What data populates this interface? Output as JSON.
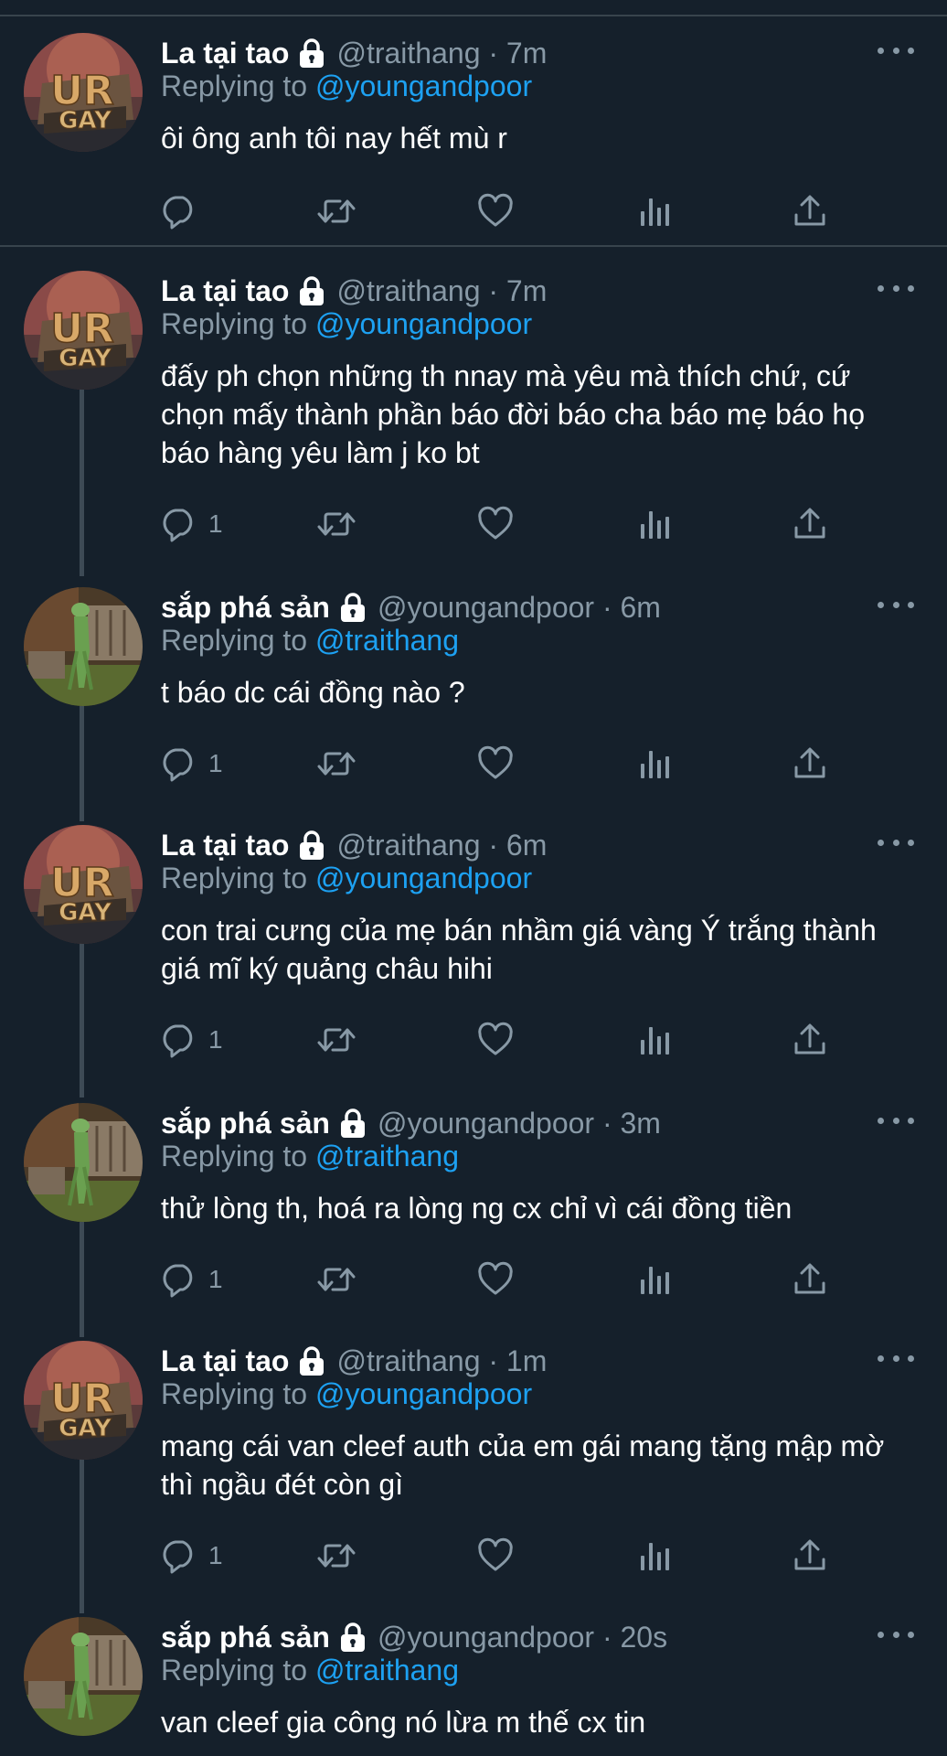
{
  "tweets": [
    {
      "author": "La tại tao",
      "handle_time": "@traithang · 7m",
      "reply_prefix": "Replying to",
      "reply_to": "@youngandpoor",
      "text": "ôi ông anh tôi nay hết mù r",
      "reply_count": "",
      "avatar": "ur-gay-logo"
    },
    {
      "author": "La tại tao",
      "handle_time": "@traithang · 7m",
      "reply_prefix": "Replying to",
      "reply_to": "@youngandpoor",
      "text": "đấy ph chọn những th nnay mà yêu mà thích chứ, cứ chọn mấy thành phần báo đời báo cha báo mẹ báo họ báo hàng yêu làm j ko bt",
      "reply_count": "1",
      "avatar": "ur-gay-logo"
    },
    {
      "author": "sắp phá sản",
      "handle_time": "@youngandpoor · 6m",
      "reply_prefix": "Replying to",
      "reply_to": "@traithang",
      "text": "t báo dc cái đồng nào ?",
      "reply_count": "1",
      "avatar": "frog-photo"
    },
    {
      "author": "La tại tao",
      "handle_time": "@traithang · 6m",
      "reply_prefix": "Replying to",
      "reply_to": "@youngandpoor",
      "text": "con trai cưng của mẹ bán nhầm giá vàng Ý trắng thành giá mĩ ký quảng châu hihi",
      "reply_count": "1",
      "avatar": "ur-gay-logo"
    },
    {
      "author": "sắp phá sản",
      "handle_time": "@youngandpoor · 3m",
      "reply_prefix": "Replying to",
      "reply_to": "@traithang",
      "text": "thử lòng th, hoá ra lòng ng cx chỉ vì cái đồng tiền",
      "reply_count": "1",
      "avatar": "frog-photo"
    },
    {
      "author": "La tại tao",
      "handle_time": "@traithang · 1m",
      "reply_prefix": "Replying to",
      "reply_to": "@youngandpoor",
      "text": "mang cái van cleef auth của em gái mang tặng mập mờ thì ngầu đét còn gì",
      "reply_count": "1",
      "avatar": "ur-gay-logo"
    },
    {
      "author": "sắp phá sản",
      "handle_time": "@youngandpoor · 20s",
      "reply_prefix": "Replying to",
      "reply_to": "@traithang",
      "text": "van cleef gia công nó lừa m thế cx tin",
      "reply_count": "",
      "avatar": "frog-photo"
    }
  ],
  "action_icons": [
    "reply-icon",
    "retweet-icon",
    "like-icon",
    "analytics-icon",
    "share-icon"
  ],
  "colors": {
    "background": "#15202b",
    "text": "#ffffff",
    "secondary": "#8899a6",
    "link": "#1da1f2",
    "divider": "#38444d"
  }
}
